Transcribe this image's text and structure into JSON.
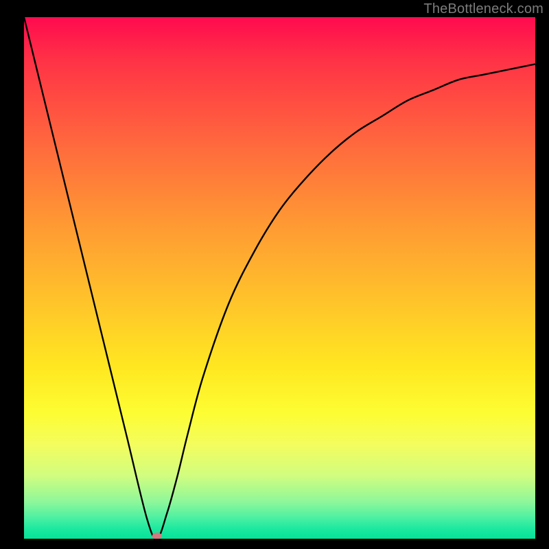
{
  "watermark": "TheBottleneck.com",
  "chart_data": {
    "type": "line",
    "title": "",
    "xlabel": "",
    "ylabel": "",
    "xlim": [
      0,
      100
    ],
    "ylim": [
      0,
      100
    ],
    "series": [
      {
        "name": "bottleneck-curve",
        "x": [
          0,
          5,
          10,
          15,
          20,
          24,
          26,
          28,
          30,
          32,
          35,
          40,
          45,
          50,
          55,
          60,
          65,
          70,
          75,
          80,
          85,
          90,
          95,
          100
        ],
        "values": [
          100,
          80,
          60,
          40,
          20,
          4,
          0,
          5,
          12,
          20,
          31,
          45,
          55,
          63,
          69,
          74,
          78,
          81,
          84,
          86,
          88,
          89,
          90,
          91
        ]
      }
    ],
    "annotations": [
      {
        "name": "minimum-marker",
        "x": 26,
        "y": 0
      }
    ],
    "background_gradient": {
      "top": "#ff0a4f",
      "bottom": "#04e39a",
      "description": "vertical rainbow red→orange→yellow→green"
    }
  }
}
